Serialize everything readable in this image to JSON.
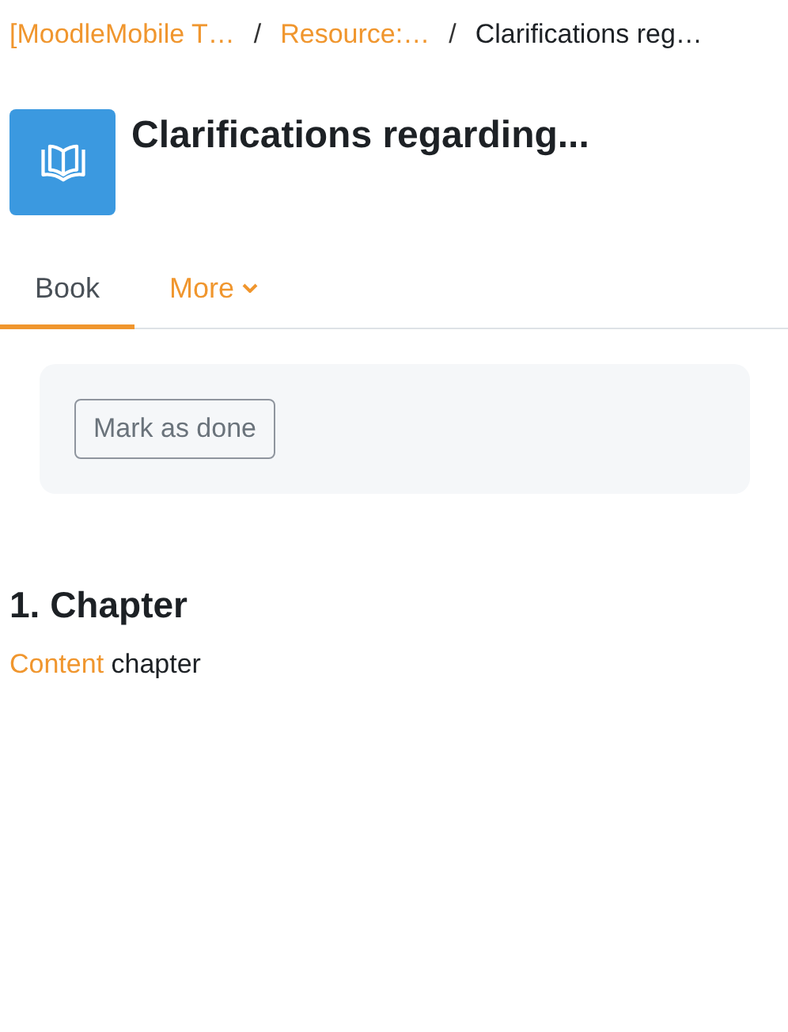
{
  "breadcrumb": [
    {
      "label": "[MoodleMobile T…",
      "kind": "link"
    },
    {
      "label": "Resource:…",
      "kind": "link",
      "separator": "/"
    },
    {
      "label": "Clarifications reg…",
      "kind": "current",
      "separator": "/"
    }
  ],
  "header": {
    "title": "Clarifications regarding..."
  },
  "tabs": [
    {
      "label": "Book",
      "selected": true,
      "dropdown": false
    },
    {
      "label": "More",
      "selected": false,
      "dropdown": true
    }
  ],
  "completion": {
    "button": "Mark as done"
  },
  "chapter": {
    "heading": "1. Chapter",
    "link": "Content",
    "text": "chapter"
  }
}
